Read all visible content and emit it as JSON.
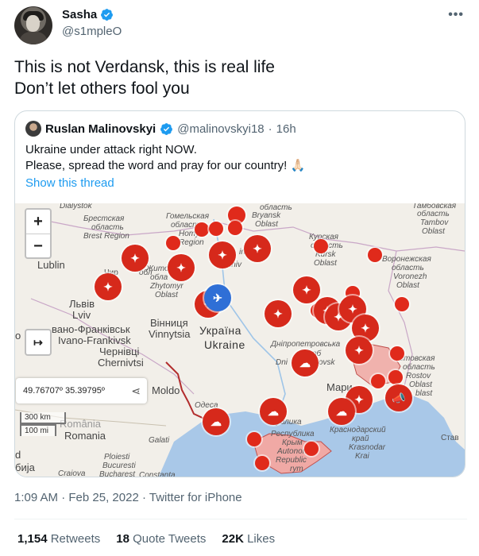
{
  "author": {
    "name": "Sasha",
    "handle": "@s1mpleO",
    "verified": true,
    "more_icon": "more-horizontal-icon"
  },
  "tweet": {
    "line1": "This is not Verdansk, this is real life",
    "line2": "Don’t let others fool you"
  },
  "quoted": {
    "name": "Ruslan Malinovskyi",
    "handle": "@malinovskyi18",
    "separator": "·",
    "time": "16h",
    "line1": "Ukraine under attack right NOW.",
    "line2": "Please, spread the word and pray for our country! 🙏🏻",
    "show_thread": "Show this thread"
  },
  "map": {
    "zoom_in": "+",
    "zoom_out": "−",
    "fullscreen": "↦",
    "coords": "49.76707º 35.39795º",
    "scale_km": "300 km",
    "scale_mi": "100 mi",
    "labels": {
      "dialystok": "Dialystok",
      "brest1": "Брестская",
      "brest2": "область",
      "brest3": "Brest Region",
      "gomel1": "Гомельская",
      "gomel2": "область",
      "gomel3": "Homyel",
      "gomel4": "Region",
      "bryansk1": "область",
      "bryansk2": "Bryansk",
      "bryansk3": "Oblast",
      "tambov1": "Тамбовская",
      "tambov2": "область",
      "tambov3": "Tambov",
      "tambov4": "Oblast",
      "kursk1": "Курская",
      "kursk2": "область",
      "kursk3": "Kursk",
      "kursk4": "Oblast",
      "voronezh1": "Воронежская",
      "voronezh2": "область",
      "voronezh3": "Voronezh",
      "voronezh4": "Oblast",
      "lublin": "Lublin",
      "zhytomyr1": "Житом",
      "zhytomyr2": "обла",
      "zhytomyr3": "Zhytomyr",
      "zhytomyr4": "Oblast",
      "lviv1": "Львів",
      "lviv2": "Lviv",
      "vinn1": "Вінниця",
      "vinn2": "Vinnytsia",
      "ukr1": "Україна",
      "ukr2": "Ukraine",
      "ivano1": "вано-Франківськ",
      "ivano2": "Ivano-Frankivsk",
      "chern1": "Чернівці",
      "chern2": "Chernivtsi",
      "dnipro1": "Дніпропетровська",
      "dnipro2": "об",
      "dnipro3": "Dni",
      "dnipro4": "ovsk",
      "rostov1": "стовская",
      "rostov2": "область",
      "rostov3": "Rostov",
      "rostov4": "Oblast",
      "moldova": "Moldo",
      "odesa": "Oдeca",
      "romania1": "România",
      "romania2": "Romania",
      "galati": "Galati",
      "ploiesti": "Ploiesti",
      "bucuresti": "Bucuresti",
      "craiova": "Craiova",
      "bucharest": "Bucharest",
      "constanta": "Constanta",
      "krasnodar1": "Краснодарский",
      "krasnodar2": "край",
      "krasnodar3": "Krasnodar",
      "krasnodar4": "Krai",
      "crimea1": "Республика",
      "crimea2": "Крым",
      "crimea3": "Autonom",
      "crimea4": "Republic",
      "crimea5": "rym",
      "crimea6": "спублика",
      "mariupol": "Мари",
      "blast": "blast",
      "staw": "Став",
      "bija": "бија",
      "d": "d",
      "o": "o",
      "chir": "Чир",
      "ir": "iri",
      "hiv": "ihiv",
      "obl": "обл"
    }
  },
  "meta": {
    "time": "1:09 AM",
    "date": "Feb 25, 2022",
    "source": "Twitter for iPhone",
    "sep": "·"
  },
  "stats": {
    "retweets_count": "1,154",
    "retweets_label": "Retweets",
    "quotes_count": "18",
    "quotes_label": "Quote Tweets",
    "likes_count": "22K",
    "likes_label": "Likes"
  },
  "colors": {
    "verified": "#1d9bf0",
    "link": "#1d9bf0",
    "marker": "#d6291b",
    "sea": "#a9c8e8"
  }
}
